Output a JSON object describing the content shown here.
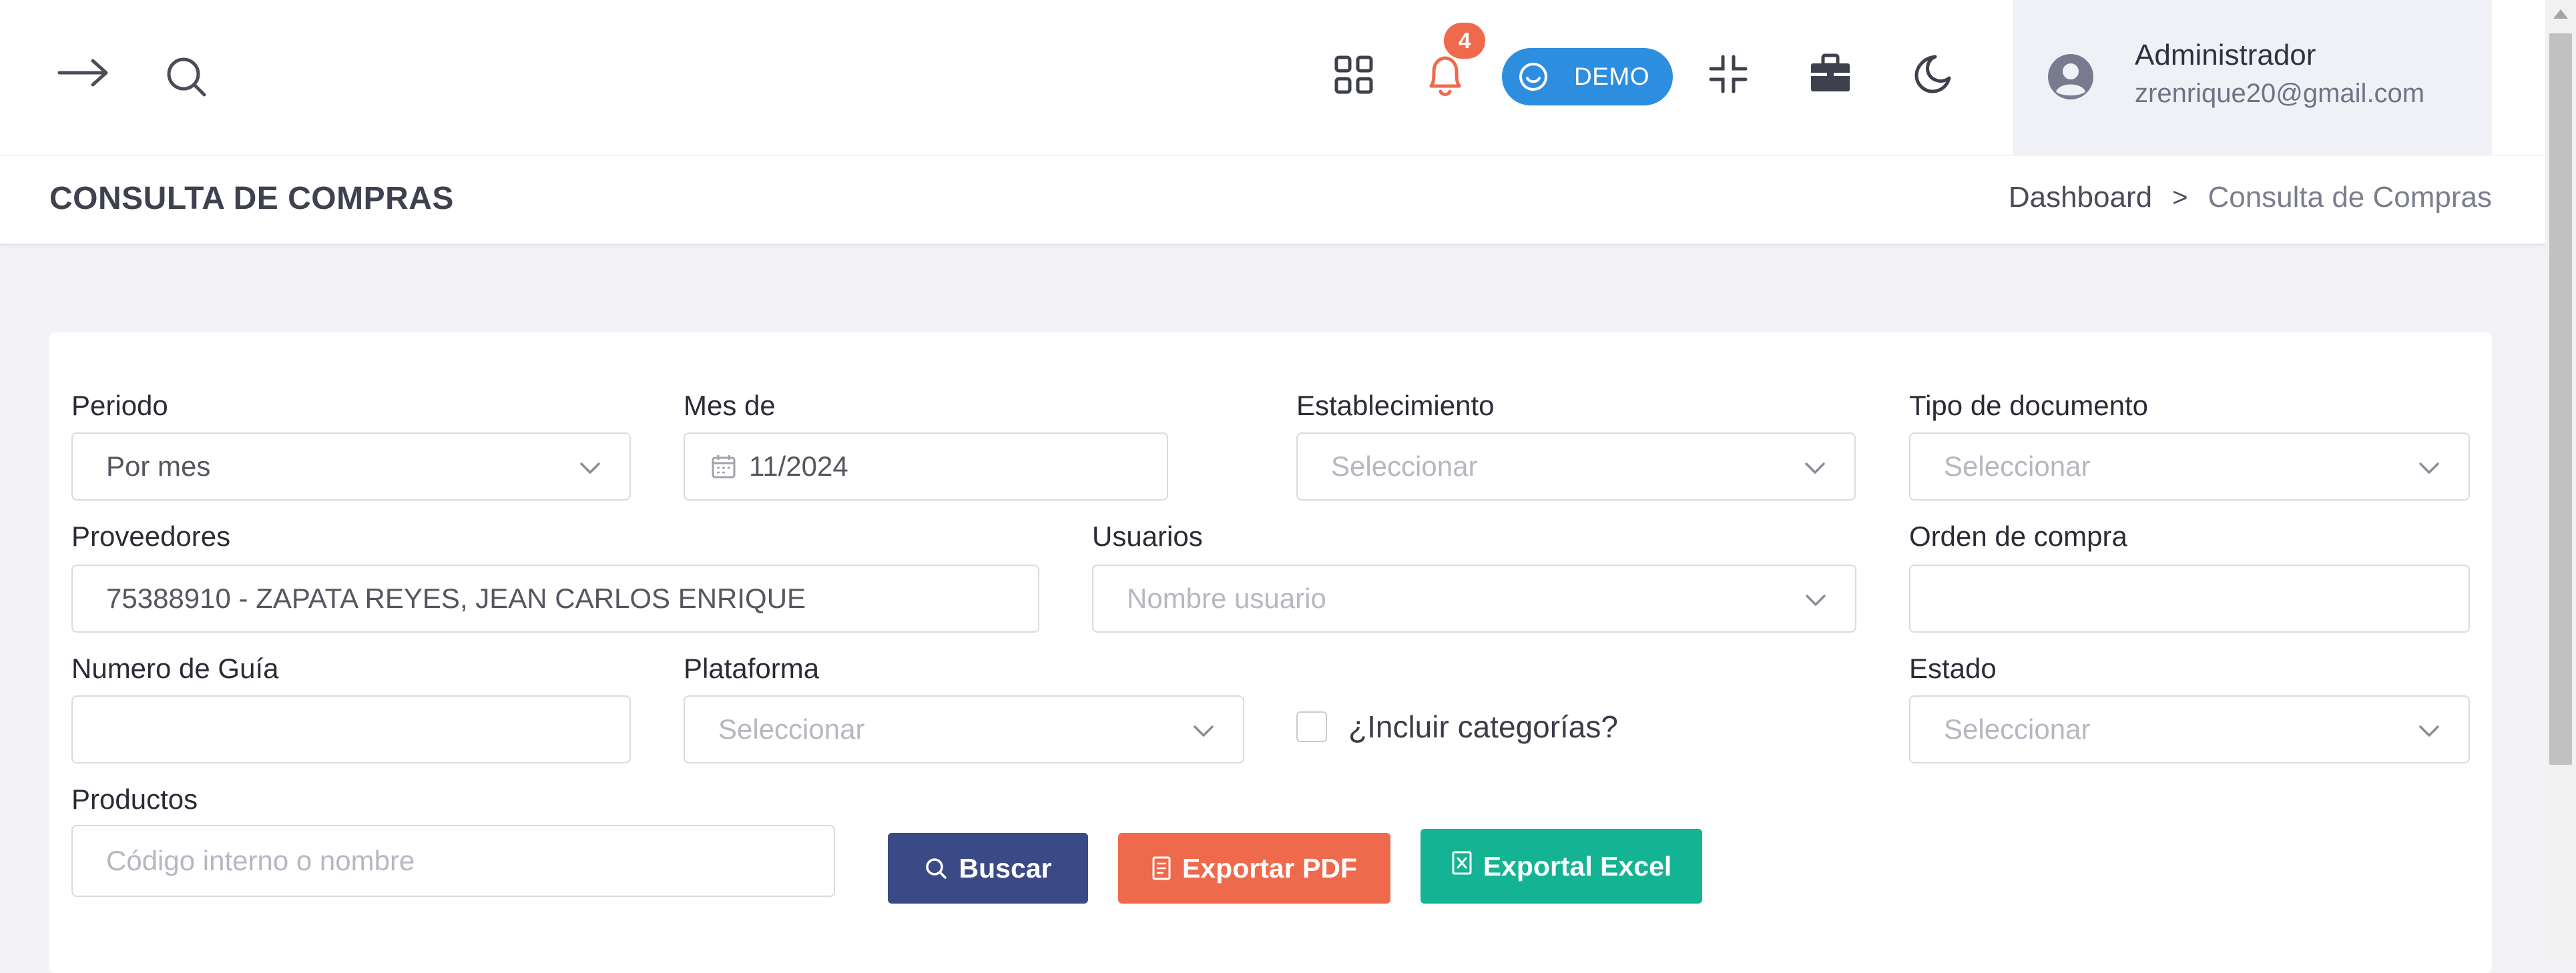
{
  "header": {
    "notifications_count": "4",
    "demo_label": "DEMO",
    "user": {
      "name": "Administrador",
      "email": "zrenrique20@gmail.com"
    }
  },
  "page": {
    "title": "CONSULTA DE COMPRAS",
    "breadcrumb": [
      "Dashboard",
      ">",
      "Consulta de Compras"
    ]
  },
  "filters": {
    "periodo": {
      "label": "Periodo",
      "value": "Por mes"
    },
    "mes_de": {
      "label": "Mes de",
      "value": "11/2024"
    },
    "establecimiento": {
      "label": "Establecimiento",
      "placeholder": "Seleccionar"
    },
    "tipo_documento": {
      "label": "Tipo de documento",
      "placeholder": "Seleccionar"
    },
    "proveedores": {
      "label": "Proveedores",
      "value": "75388910 - ZAPATA REYES, JEAN CARLOS ENRIQUE"
    },
    "usuarios": {
      "label": "Usuarios",
      "placeholder": "Nombre usuario"
    },
    "orden_compra": {
      "label": "Orden de compra",
      "value": ""
    },
    "numero_guia": {
      "label": "Numero de Guía",
      "value": ""
    },
    "plataforma": {
      "label": "Plataforma",
      "placeholder": "Seleccionar"
    },
    "incluir_categorias": {
      "label": "¿Incluir categorías?",
      "checked": false
    },
    "estado": {
      "label": "Estado",
      "placeholder": "Seleccionar"
    },
    "productos": {
      "label": "Productos",
      "placeholder": "Código interno o nombre"
    }
  },
  "actions": {
    "search": "Buscar",
    "export_pdf": "Exportar PDF",
    "export_excel": "Exportal Excel"
  },
  "colors": {
    "primary_button": "#3a4a86",
    "pdf_button": "#ef6a4c",
    "excel_button": "#13b393",
    "demo_pill": "#2d8ee0",
    "badge": "#ef6a4c"
  },
  "icons": [
    "arrow-right-icon",
    "search-icon",
    "grid-icon",
    "bell-icon",
    "smile-icon",
    "compress-icon",
    "briefcase-icon",
    "moon-icon",
    "user-avatar-icon",
    "chevron-down-icon",
    "calendar-icon",
    "file-text-icon",
    "file-excel-icon",
    "scroll-up-arrow-icon"
  ]
}
